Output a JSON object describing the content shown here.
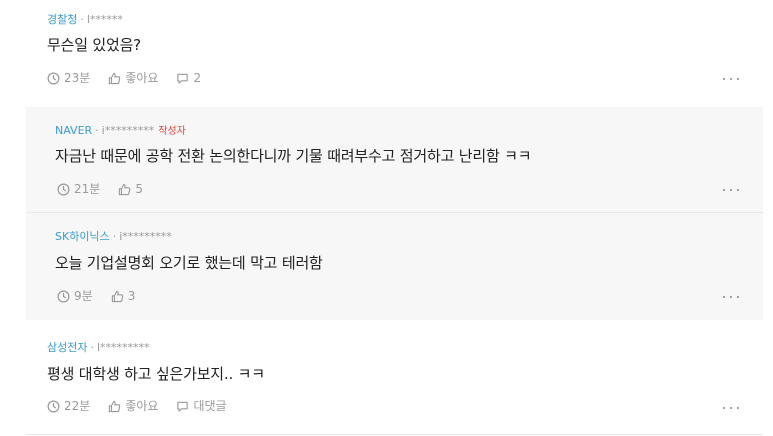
{
  "comments": [
    {
      "company": "경찰청",
      "user": "l******",
      "text": "무슨일 있었음?",
      "time": "23분",
      "like": "좋아요",
      "reply_count": "2"
    },
    {
      "company": "NAVER",
      "user": "i*********",
      "badge": "작성자",
      "text": "자금난 때문에 공학 전환 논의한다니까 기물 때려부수고 점거하고 난리함 ㅋㅋ",
      "time": "21분",
      "like": "5"
    },
    {
      "company": "SK하이닉스",
      "user": "i*********",
      "text": "오늘 기업설명회 오기로 했는데 막고 테러함",
      "time": "9분",
      "like": "3"
    },
    {
      "company": "삼성전자",
      "user": "l*********",
      "text": "평생 대학생 하고 싶은가보지.. ㅋㅋ",
      "time": "22분",
      "like": "좋아요",
      "reply": "대댓글"
    }
  ]
}
